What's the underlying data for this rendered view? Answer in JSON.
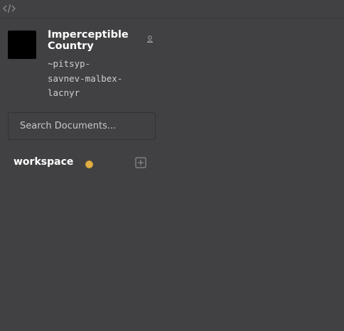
{
  "topbar": {
    "icon": "code-icon"
  },
  "profile": {
    "name": "Imperceptible Country",
    "ship": "~pitsyp-savnev-malbex-lacnyr",
    "ship_lines": [
      "~pitsyp-",
      "savnev-malbex-",
      "lacnyr"
    ],
    "avatar_color": "#000000",
    "people_icon": "people-icon"
  },
  "search": {
    "placeholder": "Search Documents...",
    "value": ""
  },
  "group": {
    "label": "workspace",
    "status_color": "#e0ae44",
    "add_icon": "plus-square-icon"
  },
  "colors": {
    "background": "#414143",
    "text": "#ffffff",
    "muted": "#cfcfd1"
  }
}
